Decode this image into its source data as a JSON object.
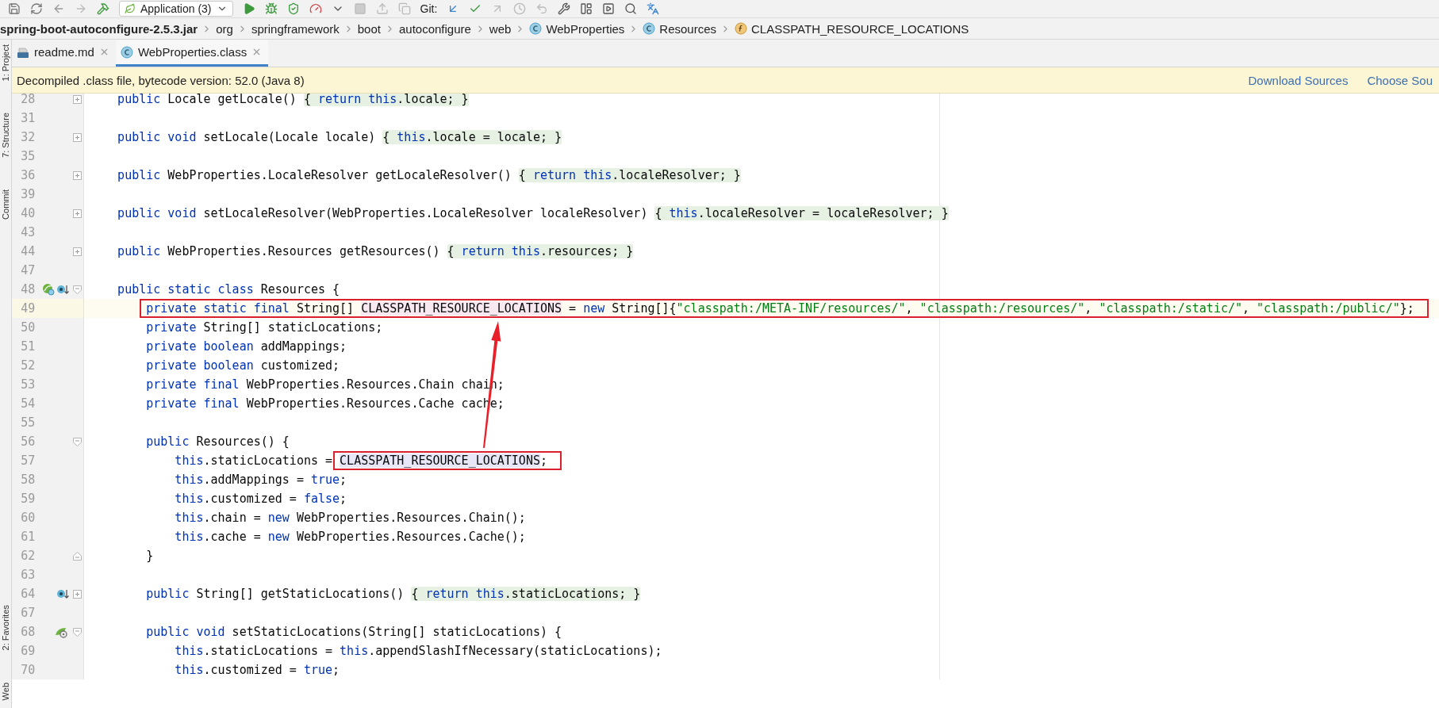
{
  "toolbar": {
    "run_config": "Application (3)",
    "git_label": "Git:"
  },
  "breadcrumb": [
    {
      "kind": "jar",
      "text": "spring-boot-autoconfigure-2.5.3.jar"
    },
    {
      "kind": "package",
      "text": "org"
    },
    {
      "kind": "package",
      "text": "springframework"
    },
    {
      "kind": "package",
      "text": "boot"
    },
    {
      "kind": "package",
      "text": "autoconfigure"
    },
    {
      "kind": "package",
      "text": "web"
    },
    {
      "kind": "class",
      "text": "WebProperties"
    },
    {
      "kind": "class",
      "text": "Resources"
    },
    {
      "kind": "field",
      "text": "CLASSPATH_RESOURCE_LOCATIONS"
    }
  ],
  "side_strip": {
    "top": [
      "1: Project",
      "7: Structure",
      "Commit"
    ],
    "bottom": [
      "2: Favorites",
      "Web"
    ]
  },
  "tabs": [
    {
      "kind": "markdown",
      "label": "readme.md",
      "selected": false
    },
    {
      "kind": "class",
      "label": "WebProperties.class",
      "selected": true
    }
  ],
  "banner": {
    "message": "Decompiled .class file, bytecode version: 52.0 (Java 8)",
    "links": [
      "Download Sources",
      "Choose Sou"
    ]
  },
  "code": [
    {
      "number": "28",
      "current": false,
      "fold": {
        "kind": "collapsed"
      },
      "tokens": [
        {
          "kind": "kw",
          "text": "    public"
        },
        {
          "kind": "plain",
          "text": " Locale getLocale() "
        },
        {
          "kind": "fold",
          "tokens": [
            {
              "kind": "plain",
              "text": "{ "
            },
            {
              "kind": "kw",
              "text": "return this"
            },
            {
              "kind": "plain",
              "text": ".locale; }"
            }
          ]
        }
      ]
    },
    {
      "number": "31",
      "current": false
    },
    {
      "number": "32",
      "current": false,
      "fold": {
        "kind": "collapsed"
      },
      "tokens": [
        {
          "kind": "kw",
          "text": "    public void"
        },
        {
          "kind": "plain",
          "text": " setLocale(Locale locale) "
        },
        {
          "kind": "fold",
          "tokens": [
            {
              "kind": "plain",
              "text": "{ "
            },
            {
              "kind": "kw",
              "text": "this"
            },
            {
              "kind": "plain",
              "text": ".locale = locale; }"
            }
          ]
        }
      ]
    },
    {
      "number": "35",
      "current": false
    },
    {
      "number": "36",
      "current": false,
      "fold": {
        "kind": "collapsed"
      },
      "tokens": [
        {
          "kind": "kw",
          "text": "    public"
        },
        {
          "kind": "plain",
          "text": " WebProperties.LocaleResolver getLocaleResolver() "
        },
        {
          "kind": "fold",
          "tokens": [
            {
              "kind": "plain",
              "text": "{ "
            },
            {
              "kind": "kw",
              "text": "return this"
            },
            {
              "kind": "plain",
              "text": ".localeResolver; }"
            }
          ]
        }
      ]
    },
    {
      "number": "39",
      "current": false
    },
    {
      "number": "40",
      "current": false,
      "fold": {
        "kind": "collapsed"
      },
      "tokens": [
        {
          "kind": "kw",
          "text": "    public void"
        },
        {
          "kind": "plain",
          "text": " setLocaleResolver(WebProperties.LocaleResolver localeResolver) "
        },
        {
          "kind": "fold",
          "tokens": [
            {
              "kind": "plain",
              "text": "{ "
            },
            {
              "kind": "kw",
              "text": "this"
            },
            {
              "kind": "plain",
              "text": ".localeResolver = localeResolver; }"
            }
          ]
        }
      ]
    },
    {
      "number": "43",
      "current": false
    },
    {
      "number": "44",
      "current": false,
      "fold": {
        "kind": "collapsed"
      },
      "tokens": [
        {
          "kind": "kw",
          "text": "    public"
        },
        {
          "kind": "plain",
          "text": " WebProperties.Resources getResources() "
        },
        {
          "kind": "fold",
          "tokens": [
            {
              "kind": "plain",
              "text": "{ "
            },
            {
              "kind": "kw",
              "text": "return this"
            },
            {
              "kind": "plain",
              "text": ".resources; }"
            }
          ]
        }
      ]
    },
    {
      "number": "47",
      "current": false
    },
    {
      "number": "48",
      "current": false,
      "fold": {
        "kind": "open"
      },
      "gutter_icons": [
        {
          "kind": "spring-class"
        },
        {
          "kind": "override-down"
        }
      ],
      "tokens": [
        {
          "kind": "kw",
          "text": "    public static class"
        },
        {
          "kind": "plain",
          "text": " Resources {"
        }
      ]
    },
    {
      "number": "49",
      "current": true,
      "tokens": [
        {
          "kind": "frame",
          "tokens": [
            {
              "kind": "kw",
              "text": "        private static final"
            },
            {
              "kind": "plain",
              "text": " String[] "
            },
            {
              "kind": "decl",
              "text": "CLASSPATH_RESOURCE_LOCATIONS"
            },
            {
              "kind": "plain",
              "text": " = "
            },
            {
              "kind": "kw",
              "text": "new"
            },
            {
              "kind": "plain",
              "text": " String[]{"
            },
            {
              "kind": "str",
              "text": "\"classpath:/META-INF/resources/\""
            },
            {
              "kind": "plain",
              "text": ", "
            },
            {
              "kind": "str",
              "text": "\"classpath:/resources/\""
            },
            {
              "kind": "plain",
              "text": ", "
            },
            {
              "kind": "str",
              "text": "\"classpath:/static/\""
            },
            {
              "kind": "plain",
              "text": ", "
            },
            {
              "kind": "str",
              "text": "\"classpath:/public/\""
            },
            {
              "kind": "plain",
              "text": "};"
            }
          ]
        }
      ]
    },
    {
      "number": "50",
      "current": false,
      "tokens": [
        {
          "kind": "kw",
          "text": "        private"
        },
        {
          "kind": "plain",
          "text": " String[] staticLocations;"
        }
      ]
    },
    {
      "number": "51",
      "current": false,
      "tokens": [
        {
          "kind": "kw",
          "text": "        private boolean"
        },
        {
          "kind": "plain",
          "text": " addMappings;"
        }
      ]
    },
    {
      "number": "52",
      "current": false,
      "tokens": [
        {
          "kind": "kw",
          "text": "        private boolean"
        },
        {
          "kind": "plain",
          "text": " customized;"
        }
      ]
    },
    {
      "number": "53",
      "current": false,
      "tokens": [
        {
          "kind": "kw",
          "text": "        private final"
        },
        {
          "kind": "plain",
          "text": " WebProperties.Resources.Chain chain;"
        }
      ]
    },
    {
      "number": "54",
      "current": false,
      "tokens": [
        {
          "kind": "kw",
          "text": "        private final"
        },
        {
          "kind": "plain",
          "text": " WebProperties.Resources.Cache cache;"
        }
      ]
    },
    {
      "number": "55",
      "current": false
    },
    {
      "number": "56",
      "current": false,
      "fold": {
        "kind": "open"
      },
      "tokens": [
        {
          "kind": "kw",
          "text": "        public"
        },
        {
          "kind": "plain",
          "text": " Resources() {"
        }
      ]
    },
    {
      "number": "57",
      "current": false,
      "tokens": [
        {
          "kind": "kw",
          "text": "            this"
        },
        {
          "kind": "plain",
          "text": ".staticLocations = "
        },
        {
          "kind": "frame",
          "tokens": [
            {
              "kind": "ref",
              "text": "CLASSPATH_RESOURCE_LOCATIONS"
            },
            {
              "kind": "plain",
              "text": ";"
            }
          ]
        }
      ]
    },
    {
      "number": "58",
      "current": false,
      "tokens": [
        {
          "kind": "kw",
          "text": "            this"
        },
        {
          "kind": "plain",
          "text": ".addMappings = "
        },
        {
          "kind": "kw",
          "text": "true"
        },
        {
          "kind": "plain",
          "text": ";"
        }
      ]
    },
    {
      "number": "59",
      "current": false,
      "tokens": [
        {
          "kind": "kw",
          "text": "            this"
        },
        {
          "kind": "plain",
          "text": ".customized = "
        },
        {
          "kind": "kw",
          "text": "false"
        },
        {
          "kind": "plain",
          "text": ";"
        }
      ]
    },
    {
      "number": "60",
      "current": false,
      "tokens": [
        {
          "kind": "kw",
          "text": "            this"
        },
        {
          "kind": "plain",
          "text": ".chain = "
        },
        {
          "kind": "kw",
          "text": "new"
        },
        {
          "kind": "plain",
          "text": " WebProperties.Resources.Chain();"
        }
      ]
    },
    {
      "number": "61",
      "current": false,
      "tokens": [
        {
          "kind": "kw",
          "text": "            this"
        },
        {
          "kind": "plain",
          "text": ".cache = "
        },
        {
          "kind": "kw",
          "text": "new"
        },
        {
          "kind": "plain",
          "text": " WebProperties.Resources.Cache();"
        }
      ]
    },
    {
      "number": "62",
      "current": false,
      "fold": {
        "kind": "end"
      },
      "tokens": [
        {
          "kind": "plain",
          "text": "        }"
        }
      ]
    },
    {
      "number": "63",
      "current": false
    },
    {
      "number": "64",
      "current": false,
      "fold": {
        "kind": "collapsed"
      },
      "gutter_icons": [
        {
          "kind": "override-down"
        }
      ],
      "tokens": [
        {
          "kind": "kw",
          "text": "        public"
        },
        {
          "kind": "plain",
          "text": " String[] getStaticLocations() "
        },
        {
          "kind": "fold",
          "tokens": [
            {
              "kind": "plain",
              "text": "{ "
            },
            {
              "kind": "kw",
              "text": "return this"
            },
            {
              "kind": "plain",
              "text": ".staticLocations; }"
            }
          ]
        }
      ]
    },
    {
      "number": "67",
      "current": false
    },
    {
      "number": "68",
      "current": false,
      "fold": {
        "kind": "open"
      },
      "gutter_icons": [
        {
          "kind": "spring-bean"
        }
      ],
      "tokens": [
        {
          "kind": "kw",
          "text": "        public void"
        },
        {
          "kind": "plain",
          "text": " setStaticLocations(String[] staticLocations) {"
        }
      ]
    },
    {
      "number": "69",
      "current": false,
      "tokens": [
        {
          "kind": "kw",
          "text": "            this"
        },
        {
          "kind": "plain",
          "text": ".staticLocations = "
        },
        {
          "kind": "kw",
          "text": "this"
        },
        {
          "kind": "plain",
          "text": ".appendSlashIfNecessary(staticLocations);"
        }
      ]
    },
    {
      "number": "70",
      "current": false,
      "tokens": [
        {
          "kind": "kw",
          "text": "            this"
        },
        {
          "kind": "plain",
          "text": ".customized = "
        },
        {
          "kind": "kw",
          "text": "true"
        },
        {
          "kind": "plain",
          "text": ";"
        }
      ]
    }
  ]
}
